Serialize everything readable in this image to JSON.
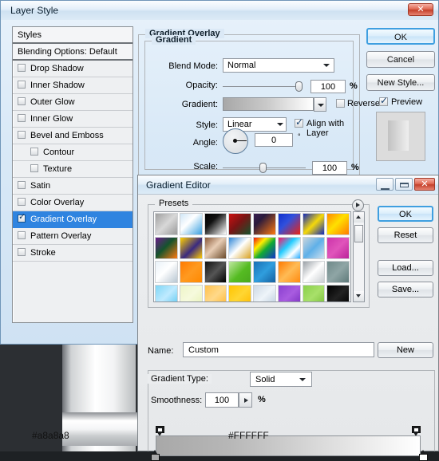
{
  "layer_style": {
    "title": "Layer Style",
    "close_glyph": "✕",
    "styles_panel": {
      "header": "Styles",
      "items": [
        {
          "label": "Blending Options: Default",
          "type": "header",
          "checked": false,
          "indent": false
        },
        {
          "label": "Drop Shadow",
          "type": "check",
          "checked": false,
          "indent": false
        },
        {
          "label": "Inner Shadow",
          "type": "check",
          "checked": false,
          "indent": false
        },
        {
          "label": "Outer Glow",
          "type": "check",
          "checked": false,
          "indent": false
        },
        {
          "label": "Inner Glow",
          "type": "check",
          "checked": false,
          "indent": false
        },
        {
          "label": "Bevel and Emboss",
          "type": "check",
          "checked": false,
          "indent": false
        },
        {
          "label": "Contour",
          "type": "check",
          "checked": false,
          "indent": true
        },
        {
          "label": "Texture",
          "type": "check",
          "checked": false,
          "indent": true
        },
        {
          "label": "Satin",
          "type": "check",
          "checked": false,
          "indent": false
        },
        {
          "label": "Color Overlay",
          "type": "check",
          "checked": false,
          "indent": false
        },
        {
          "label": "Gradient Overlay",
          "type": "check",
          "checked": true,
          "indent": false,
          "selected": true
        },
        {
          "label": "Pattern Overlay",
          "type": "check",
          "checked": false,
          "indent": false
        },
        {
          "label": "Stroke",
          "type": "check",
          "checked": false,
          "indent": false
        }
      ]
    },
    "settings": {
      "group_title": "Gradient Overlay",
      "subgroup_title": "Gradient",
      "blend_mode_label": "Blend Mode:",
      "blend_mode_value": "Normal",
      "opacity_label": "Opacity:",
      "opacity_value": "100",
      "opacity_unit": "%",
      "gradient_label": "Gradient:",
      "gradient_preview_start": "#a8a8a8",
      "gradient_preview_end": "#FFFFFF",
      "reverse_label": "Reverse",
      "reverse_checked": false,
      "style_label": "Style:",
      "style_value": "Linear",
      "align_label": "Align with Layer",
      "align_checked": true,
      "angle_label": "Angle:",
      "angle_value": "0",
      "angle_unit": "°",
      "scale_label": "Scale:",
      "scale_value": "100",
      "scale_unit": "%"
    },
    "buttons": {
      "ok": "OK",
      "cancel": "Cancel",
      "new_style": "New Style...",
      "preview_label": "Preview",
      "preview_checked": true
    }
  },
  "gradient_editor": {
    "title": "Gradient Editor",
    "window_controls": {
      "minimize": "minimize-icon",
      "maximize": "maximize-icon",
      "close": "✕"
    },
    "presets": {
      "label": "Presets",
      "menu_icon": "presets-menu-icon",
      "swatches": [
        [
          "linear-gradient(135deg,#a0a0a0,#d8d8d8 50%,#9a9a9a)",
          "linear-gradient(135deg,#cfe6f7,#ffffff 40%,#3aa0e0)",
          "linear-gradient(135deg,#000000,#111111 35%,#ffffff)",
          "linear-gradient(135deg,#cc1111,#7a1414 45%,#14532d)",
          "linear-gradient(135deg,#3a2050,#2a1a3c 30%,#ff7a10)",
          "linear-gradient(135deg,#1030cc,#3050dd 40%,#ee2211)",
          "linear-gradient(135deg,#1028bb,#f5d90a 50%,#1028bb)",
          "linear-gradient(135deg,#ff8a00,#ffe000 45%,#ff7a00)"
        ],
        [
          "linear-gradient(135deg,#6a1b8a,#14532d 45%,#ff7a10)",
          "linear-gradient(135deg,#ffd000,#3a2a80 55%,#ffcc00)",
          "linear-gradient(135deg,#8a5a3a,#e8cdb5 45%,#6a4a2a)",
          "linear-gradient(135deg,#2f86d6,#ffffff 48%,#d8a020)",
          "linear-gradient(135deg,#ee1111,#ffee00 30%,#11aa33 55%,#1133cc)",
          "linear-gradient(135deg,#ff1166,#22ccff 40%,#ffffff 70%,#22aaff)",
          "linear-gradient(135deg,#c9d4dc,#5fb0e8 50%,#cfe0ee)",
          "linear-gradient(135deg,#cc33aa,#e055bb 50%,#bb2299)"
        ],
        [
          "linear-gradient(135deg,#e8f1f8,#ffffff 45%,#b8c6d2)",
          "linear-gradient(135deg,#ff7a00,#ff9a20 50%,#ff8800)",
          "linear-gradient(135deg,#111111,#555555 50%,#000000)",
          "linear-gradient(135deg,#bfe8a0,#55bb22 55%,#4aa81e)",
          "linear-gradient(135deg,#1a6fb5,#2f9ede 50%,#1560a0)",
          "linear-gradient(135deg,#ff7a00,#ffbb55 50%,#ff8a10)",
          "linear-gradient(135deg,#9aa0a6,#ffffff 50%,#c8ccd0)",
          "linear-gradient(135deg,#6f8a8a,#8fa5a5 50%,#5f7a7a)"
        ],
        [
          "linear-gradient(135deg,#7fd6f5,#bfeaff 50%,#5ec8f0)",
          "linear-gradient(135deg,#eef5c8,#f6fadd 50%,#e8f2b8)",
          "linear-gradient(135deg,#ffc14d,#ffd98a 50%,#ffb733)",
          "linear-gradient(135deg,#ffc400,#ffd633 50%,#ffbb00)",
          "linear-gradient(135deg,#cdd9e5,#eef4f9 50%,#bccddd)",
          "linear-gradient(135deg,#8a3fd0,#a95ce0 50%,#7a2fc0)",
          "linear-gradient(135deg,#8ad04a,#a8e06a 50%,#7ac03a)",
          "linear-gradient(135deg,#000000,#222222 50%,#000000)"
        ]
      ]
    },
    "buttons": {
      "ok": "OK",
      "reset": "Reset",
      "load": "Load...",
      "save": "Save...",
      "new": "New"
    },
    "name_label": "Name:",
    "name_value": "Custom",
    "gradient_type_label": "Gradient Type:",
    "gradient_type_value": "Solid",
    "smoothness_label": "Smoothness:",
    "smoothness_value": "100",
    "smoothness_unit": "%",
    "strip": {
      "start_color": "#a8a8a8",
      "end_color": "#FFFFFF",
      "left_hex_label": "#a8a8a8",
      "right_hex_label": "#FFFFFF"
    }
  }
}
